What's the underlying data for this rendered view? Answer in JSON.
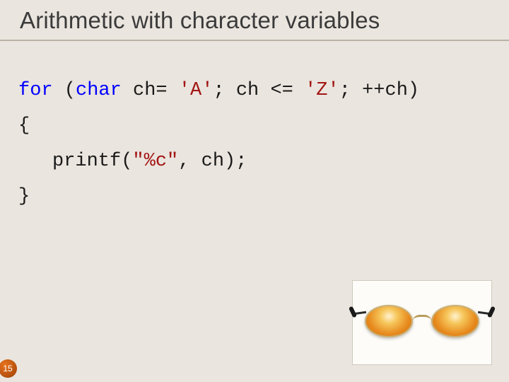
{
  "title": "Arithmetic with character variables",
  "code": {
    "line1": {
      "kw_for": "for",
      "paren_open": " (",
      "kw_char": "char",
      "seg1": " ch= ",
      "lit_A": "'A'",
      "seg2": "; ch <= ",
      "lit_Z": "'Z'",
      "seg3": "; ++ch)"
    },
    "line2": "{",
    "line3": {
      "fn": "printf(",
      "fmt": "\"%c\"",
      "rest": ", ch);"
    },
    "line4": "}"
  },
  "page_number": "15",
  "image": {
    "alt": "illustration of sunglasses with amber tinted lenses"
  }
}
